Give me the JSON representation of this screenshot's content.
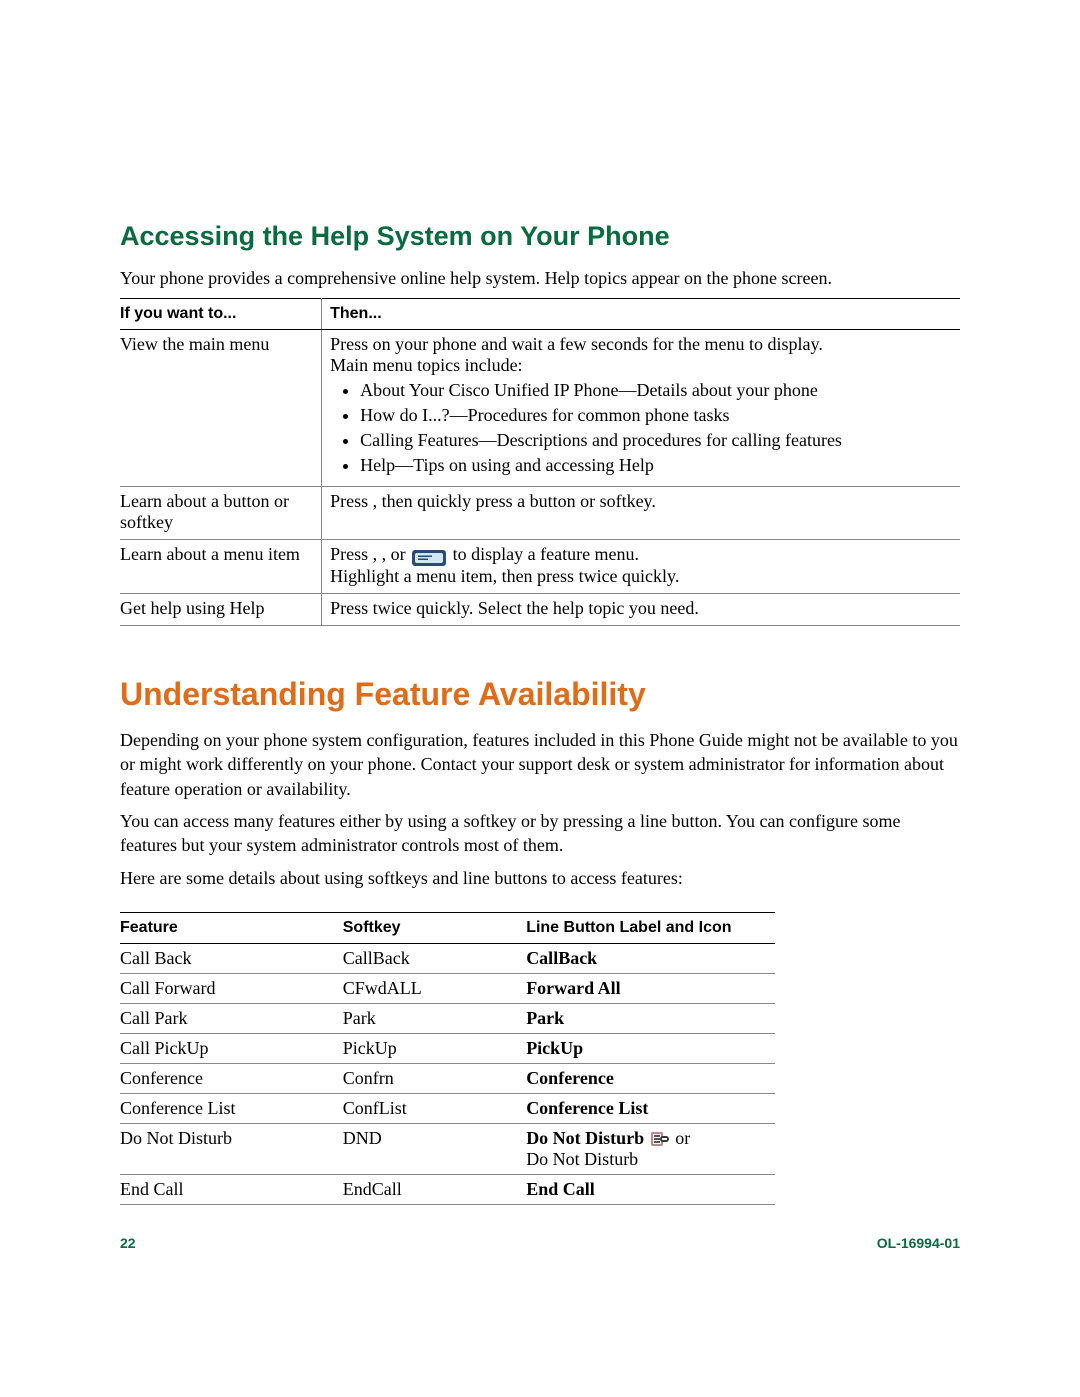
{
  "section1": {
    "heading": "Accessing the Help System on Your Phone",
    "intro": "Your phone provides a comprehensive online help system. Help topics appear on the phone screen.",
    "col_if": "If you want to...",
    "col_then": "Then...",
    "rows": [
      {
        "left": "View the main menu",
        "line1a": "Press ",
        "line1b": " on your phone and wait a few seconds for the menu to display.",
        "line2": "Main menu topics include:",
        "bullets": [
          "About Your Cisco Unified IP Phone—Details about your phone",
          "How do I...?—Procedures for common phone tasks",
          "Calling Features—Descriptions and procedures for calling features",
          "Help—Tips on using and accessing Help"
        ]
      },
      {
        "left": "Learn about a button or softkey",
        "right_a": "Press ",
        "right_b": ", then quickly press a button or softkey."
      },
      {
        "left": "Learn about a menu item",
        "r1a": "Press ",
        "r1b": ", ",
        "r1c": ", or ",
        "r1d": " to display a feature menu.",
        "r2a": "Highlight a menu item, then press ",
        "r2b": " twice quickly."
      },
      {
        "left": "Get help using Help",
        "right_a": "Press ",
        "right_b": " twice quickly. Select the help topic you need."
      }
    ]
  },
  "section2": {
    "heading": "Understanding Feature Availability",
    "p1": "Depending on your phone system configuration, features included in this Phone Guide might not be available to you or might work differently on your phone. Contact your support desk or system administrator for information about feature operation or availability.",
    "p2": "You can access many features either by using a softkey or by pressing a line button. You can configure some features but your system administrator controls most of them.",
    "p3": "Here are some details about using softkeys and line buttons to access features:",
    "col_feature": "Feature",
    "col_softkey": "Softkey",
    "col_line": "Line Button Label and Icon",
    "rows": [
      {
        "feature": "Call Back",
        "softkey": "CallBack",
        "line_bold": "CallBack",
        "line_after": ""
      },
      {
        "feature": "Call Forward",
        "softkey": "CFwdALL",
        "line_bold": "Forward All",
        "line_after": ""
      },
      {
        "feature": "Call Park",
        "softkey": "Park",
        "line_bold": "Park",
        "line_after": ""
      },
      {
        "feature": "Call PickUp",
        "softkey": "PickUp",
        "line_bold": "PickUp",
        "line_after": ""
      },
      {
        "feature": "Conference",
        "softkey": "Confrn",
        "line_bold": "Conference",
        "line_after": ""
      },
      {
        "feature": "Conference List",
        "softkey": "ConfList",
        "line_bold": "Conference List",
        "line_after": ""
      },
      {
        "feature": "Do Not Disturb",
        "softkey": "DND",
        "line_bold": "Do Not Disturb",
        "line_mid": " or",
        "line_after": "Do Not Disturb",
        "has_icon": true
      },
      {
        "feature": "End Call",
        "softkey": "EndCall",
        "line_bold": "End Call",
        "line_after": ""
      }
    ]
  },
  "footer": {
    "page": "22",
    "doc": "OL-16994-01"
  }
}
